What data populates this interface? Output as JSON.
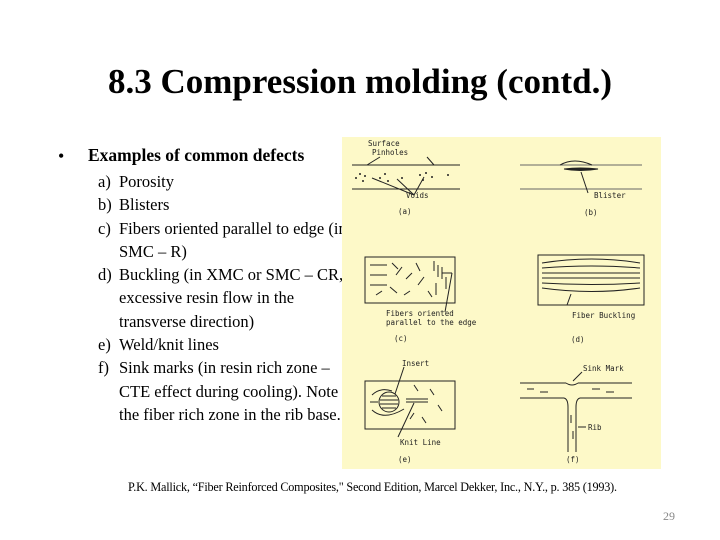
{
  "slide": {
    "title": "8.3 Compression molding (contd.)",
    "bullet": "•",
    "heading": "Examples of common defects",
    "items": [
      {
        "label": "a)",
        "text": "Porosity"
      },
      {
        "label": "b)",
        "text": "Blisters"
      },
      {
        "label": "c)",
        "text": "Fibers oriented parallel to edge (in SMC – R)"
      },
      {
        "label": "d)",
        "text": "Buckling (in XMC or SMC – CR, excessive resin flow in the transverse direction)"
      },
      {
        "label": "e)",
        "text": "Weld/knit lines"
      },
      {
        "label": "f)",
        "text": "Sink marks (in resin rich zone – CTE effect during cooling). Note the fiber rich zone in the rib base."
      }
    ],
    "citation": "P.K. Mallick, “Fiber Reinforced Composites,\" Second Edition,  Marcel Dekker, Inc., N.Y., p.  385 (1993).",
    "page_number": "29"
  },
  "figure": {
    "background": "#fdf9c8",
    "panels": {
      "a": {
        "caption": "(a)",
        "labels": [
          "Surface",
          "Pinholes",
          "Voids"
        ]
      },
      "b": {
        "caption": "(b)",
        "labels": [
          "Blister"
        ]
      },
      "c": {
        "caption": "(c)",
        "labels": [
          "Fibers oriented",
          "parallel to the edge"
        ]
      },
      "d": {
        "caption": "(d)",
        "labels": [
          "Fiber Buckling"
        ]
      },
      "e": {
        "caption": "(e)",
        "labels": [
          "Insert",
          "Knit Line"
        ]
      },
      "f": {
        "caption": "(f)",
        "labels": [
          "Sink Mark",
          "Rib"
        ]
      }
    }
  }
}
